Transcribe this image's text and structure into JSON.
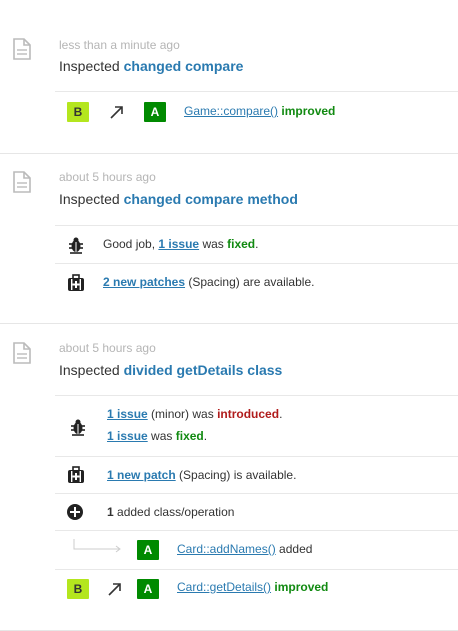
{
  "entries": [
    {
      "time": "less than a minute ago",
      "title_verb": "Inspected",
      "title_link": "changed compare",
      "rows": {
        "r1": {
          "from_grade": "B",
          "to_grade": "A",
          "method": "Game::compare()",
          "status": "improved"
        }
      }
    },
    {
      "time": "about 5 hours ago",
      "title_verb": "Inspected",
      "title_link": "changed compare method",
      "rows": {
        "issues": {
          "prefix": "Good job,",
          "count_link": "1 issue",
          "middle": "was",
          "status": "fixed",
          "end": "."
        },
        "patches": {
          "link": "2 new patches",
          "rest": "(Spacing) are available."
        }
      }
    },
    {
      "time": "about 5 hours ago",
      "title_verb": "Inspected",
      "title_link": "divided getDetails class",
      "rows": {
        "issues": {
          "line1_link": "1 issue",
          "line1_mid": "(minor) was",
          "line1_status": "introduced",
          "line1_end": ".",
          "line2_link": "1 issue",
          "line2_mid": "was",
          "line2_status": "fixed",
          "line2_end": "."
        },
        "patch": {
          "link": "1 new patch",
          "rest": "(Spacing) is available."
        },
        "added": {
          "count": "1",
          "rest": "added class/operation"
        },
        "added_item": {
          "grade": "A",
          "method": "Card::addNames()",
          "status": "added"
        },
        "improved": {
          "from_grade": "B",
          "to_grade": "A",
          "method": "Card::getDetails()",
          "status": "improved"
        }
      }
    }
  ],
  "colors": {
    "link": "#2a7ab0",
    "good": "#118a11",
    "bad": "#b01c1c",
    "grade_a": "#008a00",
    "grade_b": "#b4e61e"
  }
}
